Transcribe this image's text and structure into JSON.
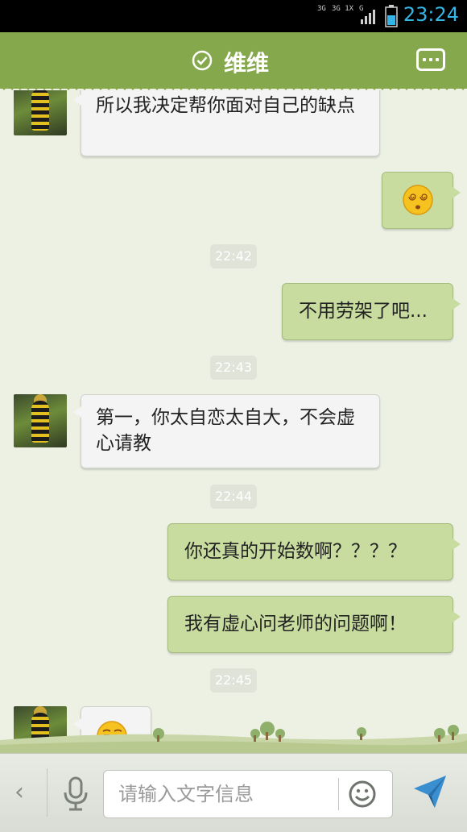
{
  "status_bar": {
    "net1": "3G",
    "net2": "3G 1X",
    "net3": "G",
    "time": "23:24"
  },
  "header": {
    "title": "维维",
    "status_icon": "check-circle-icon",
    "menu_icon": "more-icon"
  },
  "messages": [
    {
      "from": "other",
      "text": "所以我决定帮你面对自己的缺点"
    },
    {
      "from": "me",
      "emoji": "dizzy-face-emoji"
    },
    {
      "type": "time",
      "text": "22:42"
    },
    {
      "from": "me",
      "text": "不用劳架了吧..."
    },
    {
      "type": "time",
      "text": "22:43"
    },
    {
      "from": "other",
      "text": "第一，你太自恋太自大，不会虚心请教"
    },
    {
      "type": "time",
      "text": "22:44"
    },
    {
      "from": "me",
      "text": "你还真的开始数啊？？？？"
    },
    {
      "from": "me",
      "text": "我有虚心问老师的问题啊！"
    },
    {
      "type": "time",
      "text": "22:45"
    },
    {
      "from": "other",
      "emoji": "smirk-face-emoji"
    }
  ],
  "input_bar": {
    "placeholder": "请输入文字信息",
    "left_icon": "chevron-left-icon",
    "voice_icon": "microphone-icon",
    "emoji_icon": "smiley-icon",
    "send_icon": "send-icon"
  },
  "colors": {
    "header": "#86a84c",
    "my_bubble": "#c8dca0",
    "their_bubble": "#f4f4f4",
    "chat_bg": "#ecf1e4",
    "time_color": "#35b5e5"
  }
}
